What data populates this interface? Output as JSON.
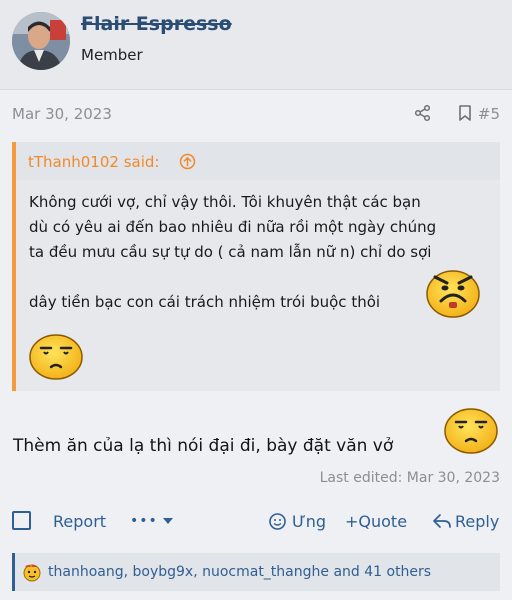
{
  "author": {
    "username": "Flair Espresso",
    "title": "Member",
    "avatar_icon": "user-avatar-photo"
  },
  "post": {
    "date": "Mar 30, 2023",
    "number": "#5",
    "share_icon": "share-icon",
    "bookmark_icon": "bookmark-icon",
    "quote": {
      "author_line": "tThanh0102 said:",
      "lines": [
        "Không cưới vợ, chỉ vậy thôi. Tôi khuyên thật các bạn",
        "dù có yêu ai đến bao nhiêu đi nữa rồi một ngày chúng",
        "ta đều mưu cầu sự tự do ( cả nam lẫn nữ n) chỉ do sợi",
        "dây tiền bạc con cái trách nhiệm trói buộc thôi"
      ]
    },
    "message": "Thèm ăn của lạ thì nói đại đi, bày đặt văn vở",
    "edited": "Last edited: Mar 30, 2023"
  },
  "actions": {
    "report": "Report",
    "more": "•••",
    "react": "Ưng",
    "quote": "+Quote",
    "reply": "Reply"
  },
  "reactions": {
    "text": "thanhoang, boybg9x, nuocmat_thanghe and 41 others"
  },
  "colors": {
    "link": "#2f5f93",
    "quote_accent": "#f39a3c",
    "muted": "#8a8f96"
  }
}
